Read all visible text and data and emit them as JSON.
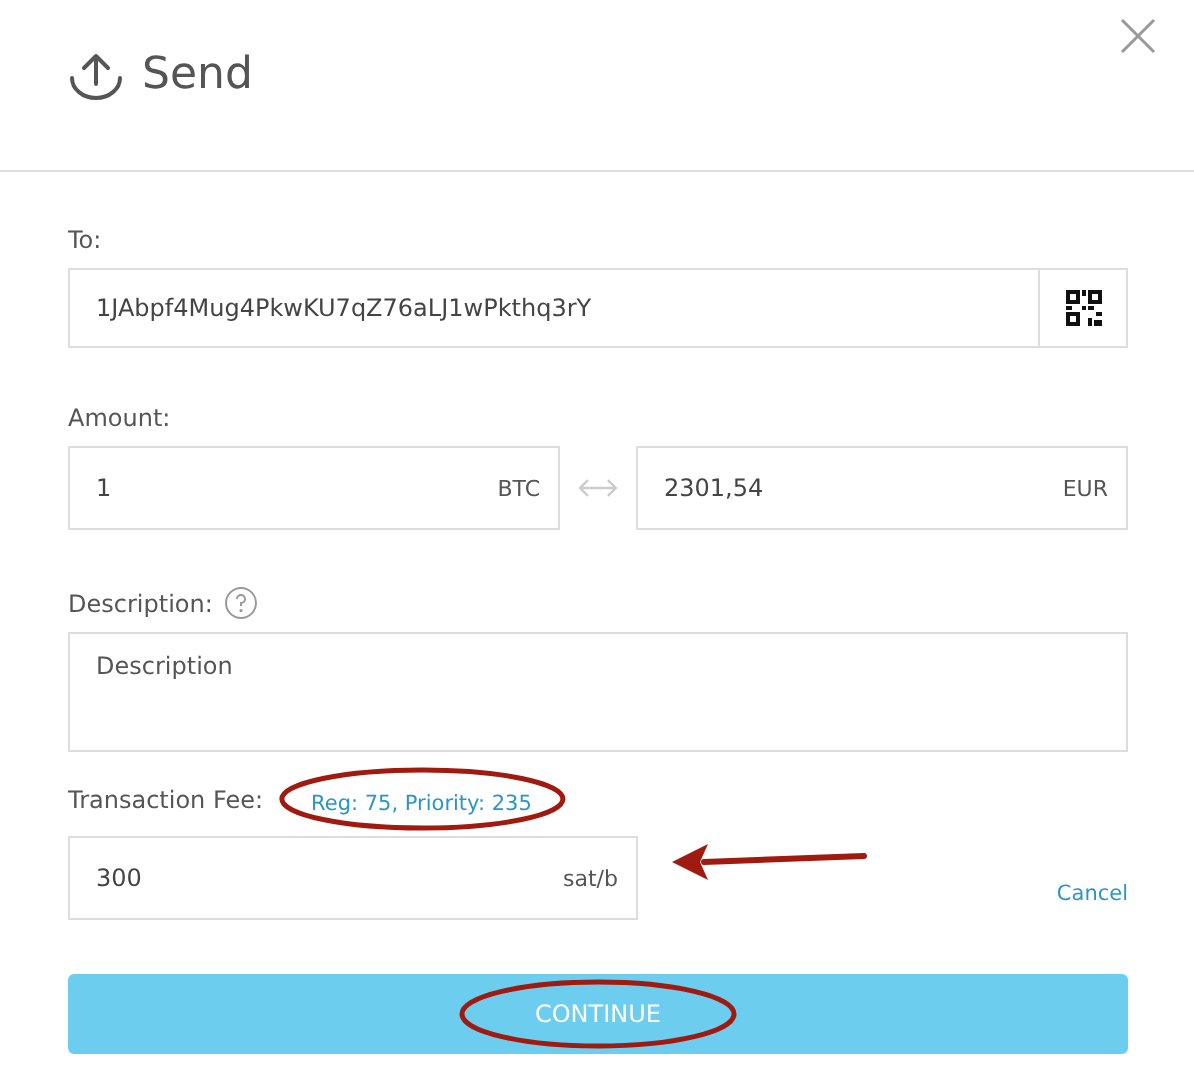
{
  "dialog": {
    "title": "Send"
  },
  "to": {
    "label": "To:",
    "value": "1JAbpf4Mug4PkwKU7qZ76aLJ1wPkthq3rY"
  },
  "amount": {
    "label": "Amount:",
    "crypto_value": "1",
    "crypto_unit": "BTC",
    "fiat_value": "2301,54",
    "fiat_unit": "EUR"
  },
  "description": {
    "label": "Description:",
    "placeholder": "Description"
  },
  "fee": {
    "label": "Transaction Fee:",
    "hint": "Reg: 75, Priority: 235",
    "value": "300",
    "unit": "sat/b",
    "cancel": "Cancel"
  },
  "continue_button": "CONTINUE"
}
